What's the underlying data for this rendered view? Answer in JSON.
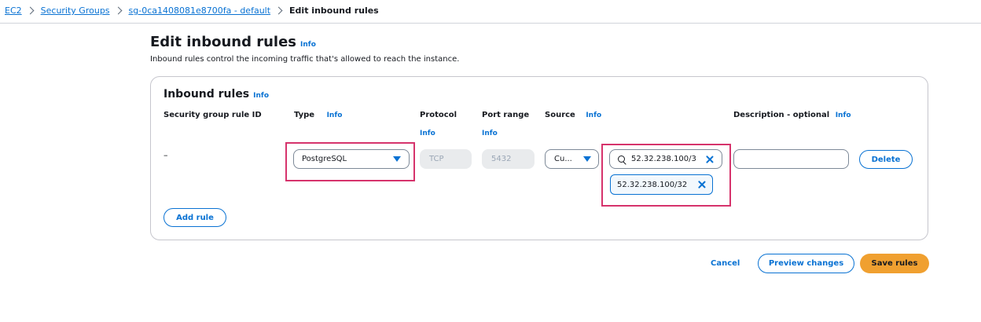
{
  "breadcrumb": {
    "items": [
      "EC2",
      "Security Groups",
      "sg-0ca1408081e8700fa - default"
    ],
    "current": "Edit inbound rules"
  },
  "page": {
    "title": "Edit inbound rules",
    "title_info": "Info",
    "description": "Inbound rules control the incoming traffic that's allowed to reach the instance."
  },
  "panel": {
    "title": "Inbound rules",
    "title_info": "Info",
    "columns": {
      "rule_id": "Security group rule ID",
      "type": "Type",
      "type_info": "Info",
      "protocol": "Protocol",
      "protocol_info": "Info",
      "port_range": "Port range",
      "port_range_info": "Info",
      "source": "Source",
      "source_info": "Info",
      "description": "Description - optional",
      "description_info": "Info"
    },
    "rule": {
      "rule_id": "–",
      "type_value": "PostgreSQL",
      "protocol_value": "TCP",
      "port_value": "5432",
      "source_type_value": "Cu...",
      "source_search_value": "52.32.238.100/3",
      "source_token": "52.32.238.100/32",
      "description_value": "",
      "delete_label": "Delete"
    },
    "add_rule_label": "Add rule"
  },
  "footer": {
    "cancel_label": "Cancel",
    "preview_label": "Preview changes",
    "save_label": "Save rules"
  },
  "colors": {
    "accent": "#0972d3",
    "primary_button": "#f0a030",
    "highlight": "#d6336c"
  }
}
